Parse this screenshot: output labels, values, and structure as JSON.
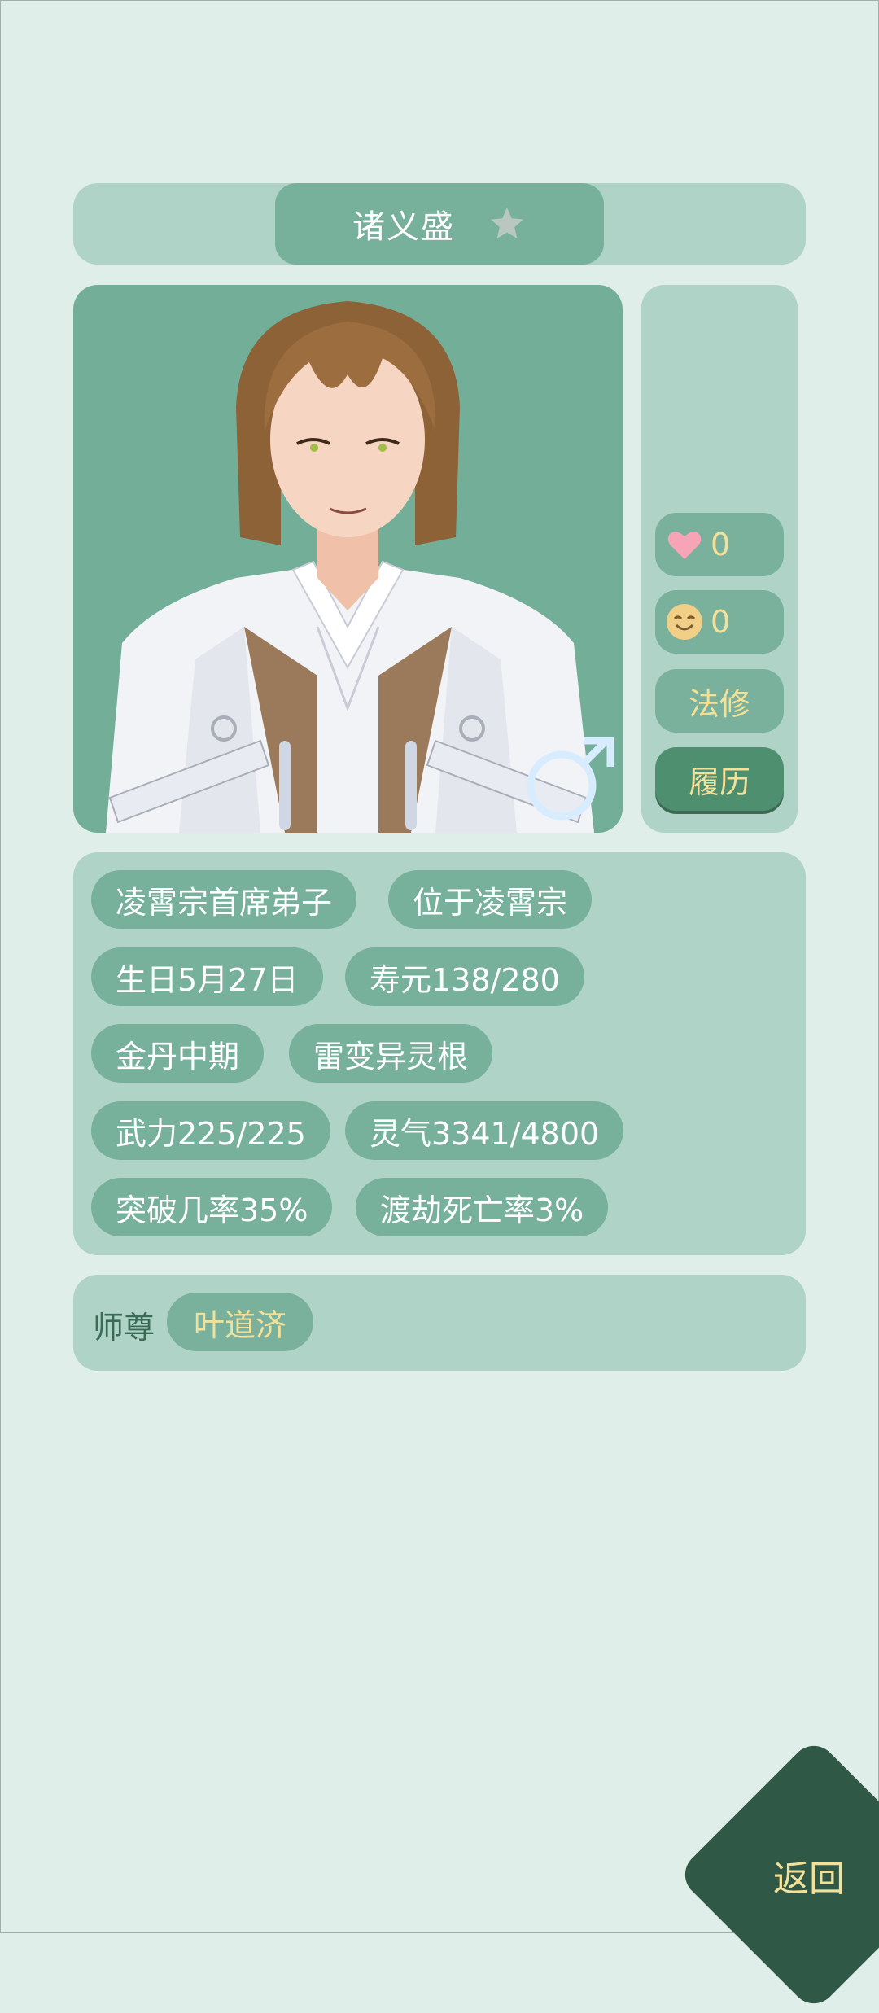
{
  "character": {
    "name": "诸义盛",
    "favorite": false,
    "gender_symbol": "♂"
  },
  "side": {
    "hearts": "0",
    "mood": "0",
    "path": "法修",
    "history_label": "履历"
  },
  "tags": [
    "凌霄宗首席弟子",
    "位于凌霄宗",
    "生日5月27日",
    "寿元138/280",
    "金丹中期",
    "雷变异灵根",
    "武力225/225",
    "灵气3341/4800",
    "突破几率35%",
    "渡劫死亡率3%"
  ],
  "master": {
    "label": "师尊",
    "name": "叶道济"
  },
  "back_label": "返回",
  "colors": {
    "background": "#dfeee8",
    "panel": "#afd3c6",
    "pill": "#77b09b",
    "accent_text": "#f4e199",
    "button_dark": "#2f5846"
  }
}
